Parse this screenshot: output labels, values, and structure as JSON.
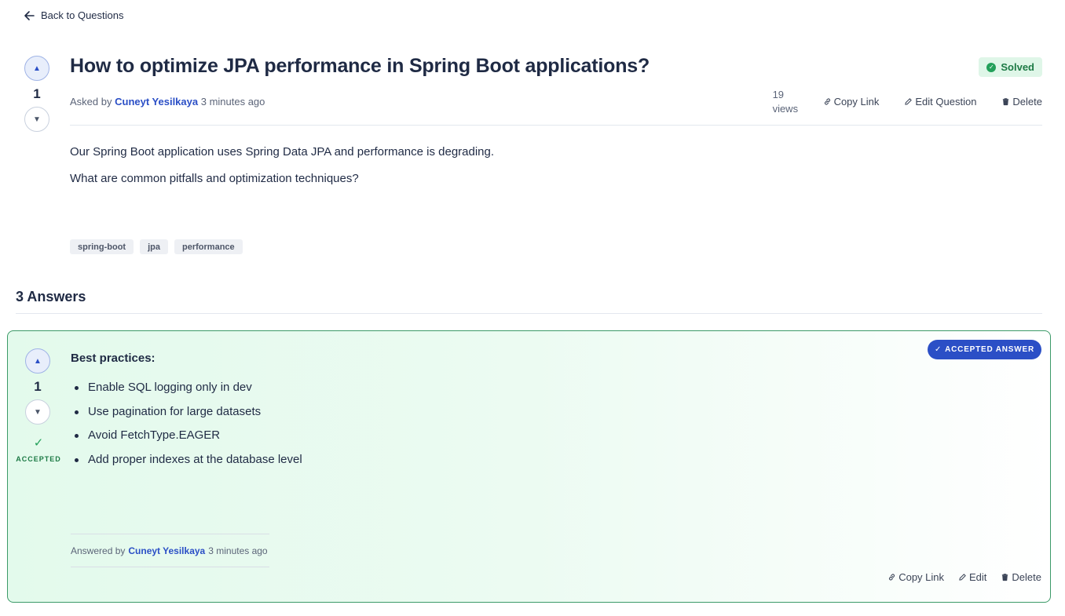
{
  "nav": {
    "back_label": "Back to Questions"
  },
  "question": {
    "title": "How to optimize JPA performance in Spring Boot applications?",
    "status": "Solved",
    "votes": "1",
    "asked_by_prefix": "Asked by",
    "author": "Cuneyt Yesilkaya",
    "time": "3 minutes ago",
    "views_count": "19",
    "views_label": "views",
    "actions": {
      "copy_link": "Copy Link",
      "edit": "Edit Question",
      "delete": "Delete"
    },
    "body": [
      "Our Spring Boot application uses Spring Data JPA and performance is degrading.",
      "What are common pitfalls and optimization techniques?"
    ],
    "tags": [
      "spring-boot",
      "jpa",
      "performance"
    ]
  },
  "answers_heading": "3 Answers",
  "answer": {
    "votes": "1",
    "accepted_label": "ACCEPTED",
    "accepted_badge": "ACCEPTED ANSWER",
    "heading": "Best practices:",
    "items": [
      "Enable SQL logging only in dev",
      "Use pagination for large datasets",
      "Avoid FetchType.EAGER",
      "Add proper indexes at the database level"
    ],
    "answered_by_prefix": "Answered by",
    "author": "Cuneyt Yesilkaya",
    "time": "3 minutes ago",
    "actions": {
      "copy_link": "Copy Link",
      "edit": "Edit",
      "delete": "Delete"
    }
  },
  "colors": {
    "accent": "#2b4fc6",
    "success": "#23a05a",
    "accepted_border": "#3c9a68"
  },
  "icons": [
    "arrow-left-icon",
    "upvote-icon",
    "downvote-icon",
    "check-circle-icon",
    "link-icon",
    "pencil-icon",
    "trash-icon",
    "check-icon"
  ]
}
